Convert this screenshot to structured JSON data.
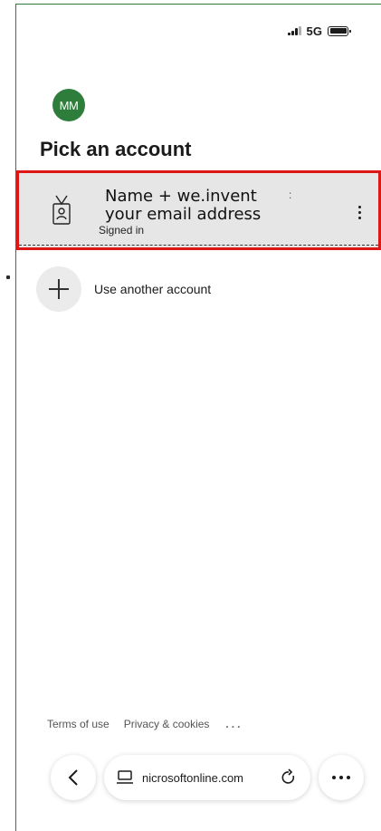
{
  "status_bar": {
    "network": "5G",
    "signal_icon": "cellular-signal-icon",
    "battery_icon": "battery-icon"
  },
  "header": {
    "avatar_initials": "MM",
    "avatar_color": "#2e7d3a",
    "title": "Pick an account"
  },
  "accounts": [
    {
      "icon": "id-badge-icon",
      "name": "Name + we.invent",
      "email": "your email address",
      "status": "Signed in",
      "colon_mark": ":",
      "highlight_color": "#e01515"
    }
  ],
  "use_another": {
    "icon": "plus-icon",
    "label": "Use another account"
  },
  "footer": {
    "terms": "Terms of use",
    "privacy": "Privacy & cookies",
    "more": "..."
  },
  "browser_bar": {
    "back_icon": "chevron-left-icon",
    "url_icon": "laptop-icon",
    "url": "nicrosoftonline.com",
    "reload_icon": "reload-icon",
    "menu_icon": "more-horizontal-icon"
  }
}
